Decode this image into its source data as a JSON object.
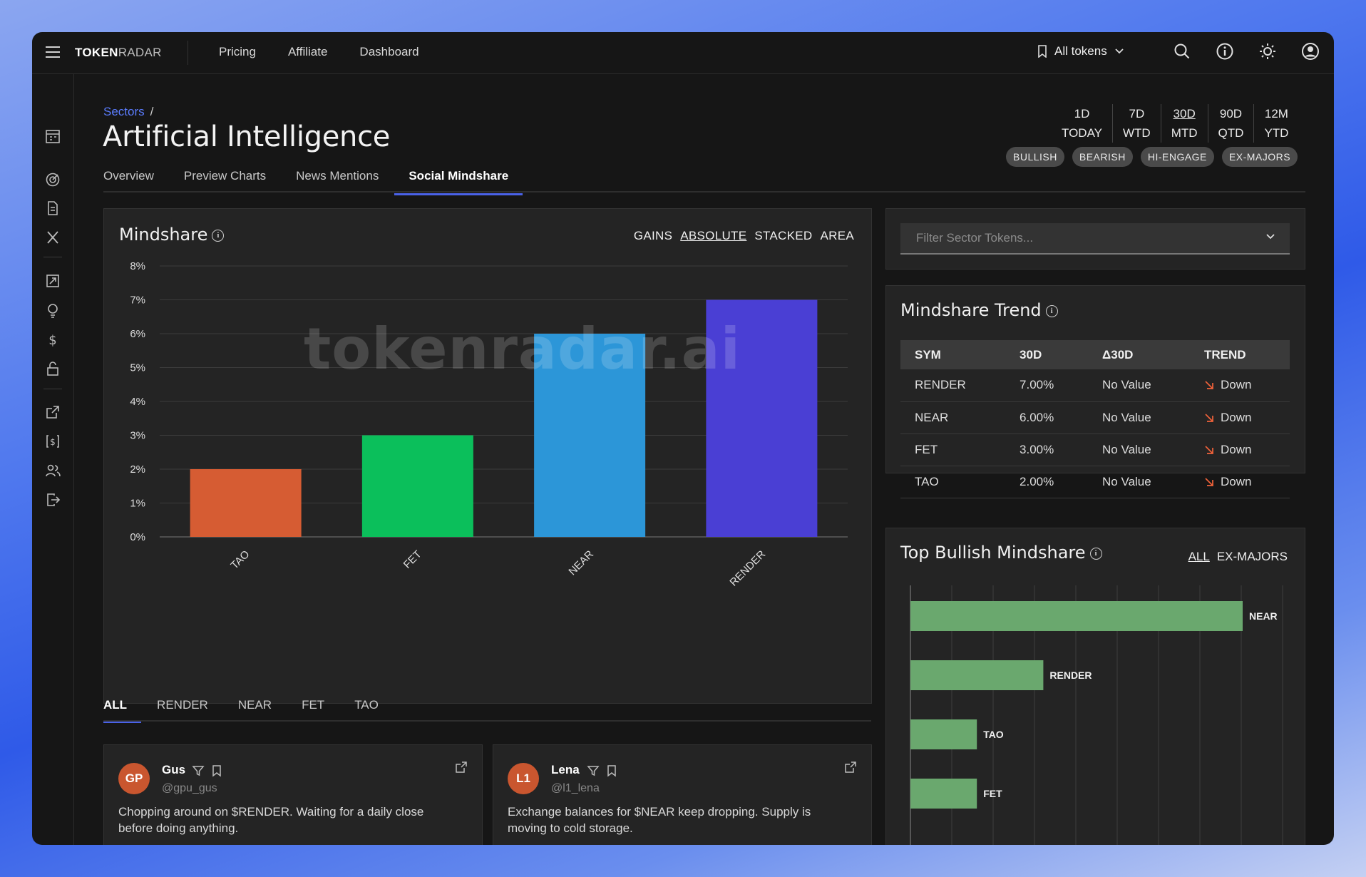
{
  "brand": {
    "bold": "TOKEN",
    "light": "RADAR"
  },
  "topnav": [
    "Pricing",
    "Affiliate",
    "Dashboard"
  ],
  "token_select": "All tokens",
  "breadcrumb": {
    "parent": "Sectors",
    "sep": "/"
  },
  "page_title": "Artificial Intelligence",
  "tabs": [
    "Overview",
    "Preview Charts",
    "News Mentions",
    "Social Mindshare"
  ],
  "periods": [
    {
      "top": "1D",
      "bottom": "TODAY"
    },
    {
      "top": "7D",
      "bottom": "WTD"
    },
    {
      "top": "30D",
      "bottom": "MTD"
    },
    {
      "top": "90D",
      "bottom": "QTD"
    },
    {
      "top": "12M",
      "bottom": "YTD"
    }
  ],
  "pills": [
    "BULLISH",
    "BEARISH",
    "HI-ENGAGE",
    "EX-MAJORS"
  ],
  "mindshare": {
    "title": "Mindshare",
    "modes": [
      "GAINS",
      "ABSOLUTE",
      "STACKED",
      "AREA"
    ],
    "watermark": "tokenradar.ai"
  },
  "feed_tabs": [
    "ALL",
    "RENDER",
    "NEAR",
    "FET",
    "TAO"
  ],
  "posts": [
    {
      "initials": "GP",
      "name": "Gus",
      "handle": "@gpu_gus",
      "text": "Chopping around on $RENDER. Waiting for a daily close before doing anything."
    },
    {
      "initials": "L1",
      "name": "Lena",
      "handle": "@l1_lena",
      "text": "Exchange balances for $NEAR keep dropping. Supply is moving to cold storage."
    }
  ],
  "filter_placeholder": "Filter Sector Tokens...",
  "trend": {
    "title": "Mindshare Trend",
    "headers": [
      "SYM",
      "30D",
      "Δ30D",
      "TREND"
    ],
    "rows": [
      {
        "sym": "RENDER",
        "v30": "7.00%",
        "delta": "No Value",
        "trend": "Down"
      },
      {
        "sym": "NEAR",
        "v30": "6.00%",
        "delta": "No Value",
        "trend": "Down"
      },
      {
        "sym": "FET",
        "v30": "3.00%",
        "delta": "No Value",
        "trend": "Down"
      },
      {
        "sym": "TAO",
        "v30": "2.00%",
        "delta": "No Value",
        "trend": "Down"
      }
    ]
  },
  "bullish": {
    "title": "Top Bullish Mindshare",
    "toggle": [
      "ALL",
      "EX-MAJORS"
    ]
  },
  "colors": {
    "accent": "#4a62e8",
    "link": "#5b7dff",
    "down": "#f0623a"
  },
  "chart_data": [
    {
      "type": "bar",
      "title": "Mindshare",
      "categories": [
        "TAO",
        "FET",
        "NEAR",
        "RENDER"
      ],
      "values": [
        2,
        3,
        6,
        7
      ],
      "colors": [
        "#d65c33",
        "#0bbf5b",
        "#2c96d8",
        "#4a3fd4"
      ],
      "ylim": [
        0,
        8
      ],
      "yticks": [
        "0%",
        "1%",
        "2%",
        "3%",
        "4%",
        "5%",
        "6%",
        "7%",
        "8%"
      ],
      "grid": true
    },
    {
      "type": "bar",
      "orientation": "horizontal",
      "title": "Top Bullish Mindshare",
      "categories": [
        "NEAR",
        "RENDER",
        "TAO",
        "FET"
      ],
      "values": [
        8,
        3.2,
        1.6,
        1.6
      ],
      "color": "#6aa86e",
      "grid": true
    }
  ]
}
